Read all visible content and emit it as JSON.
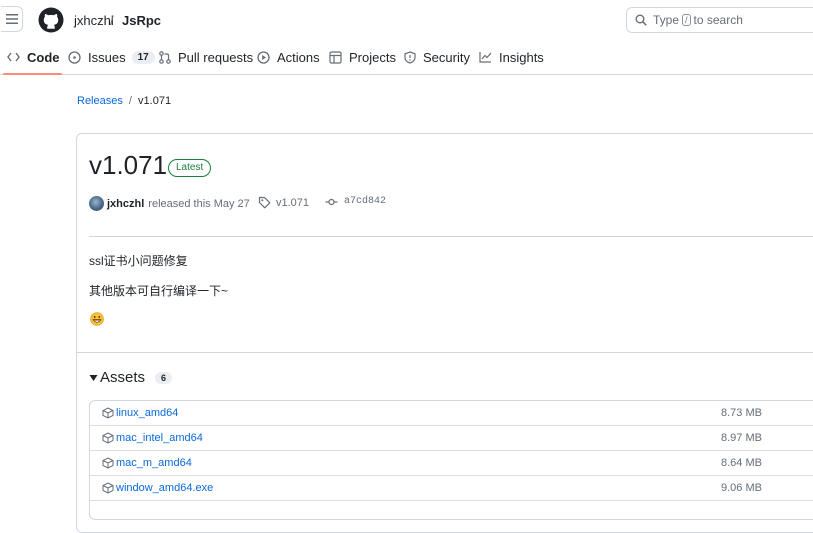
{
  "header": {
    "owner": "jxhczhl",
    "separator": "/",
    "repo": "JsRpc",
    "search": {
      "prefix": "Type",
      "key": "/",
      "suffix": "to search"
    }
  },
  "tabs": [
    {
      "label": "Code",
      "icon": "code-icon",
      "active": true
    },
    {
      "label": "Issues",
      "icon": "issue-icon",
      "count": "17"
    },
    {
      "label": "Pull requests",
      "icon": "pull-request-icon"
    },
    {
      "label": "Actions",
      "icon": "play-icon"
    },
    {
      "label": "Projects",
      "icon": "table-icon"
    },
    {
      "label": "Security",
      "icon": "shield-icon"
    },
    {
      "label": "Insights",
      "icon": "graph-icon"
    }
  ],
  "breadcrumb": {
    "link": "Releases",
    "separator": "/",
    "current": "v1.071"
  },
  "release": {
    "title": "v1.071",
    "badge": "Latest",
    "author": "jxhczhl",
    "released_text": "released this May 27",
    "tag": "v1.071",
    "commit": "a7cd842",
    "notes": [
      "ssl证书小问题修复",
      "其他版本可自行编译一下~"
    ],
    "emoji": "grinning-face-emoji"
  },
  "assets": {
    "title": "Assets",
    "count": "6",
    "items": [
      {
        "name": "linux_amd64",
        "size": "8.73 MB"
      },
      {
        "name": "mac_intel_amd64",
        "size": "8.97 MB"
      },
      {
        "name": "mac_m_amd64",
        "size": "8.64 MB"
      },
      {
        "name": "window_amd64.exe",
        "size": "9.06 MB"
      }
    ]
  },
  "colors": {
    "link": "#0969da",
    "latest_badge": "#1a7f37",
    "tab_underline": "#fd8c73",
    "border": "#d0d7de"
  }
}
